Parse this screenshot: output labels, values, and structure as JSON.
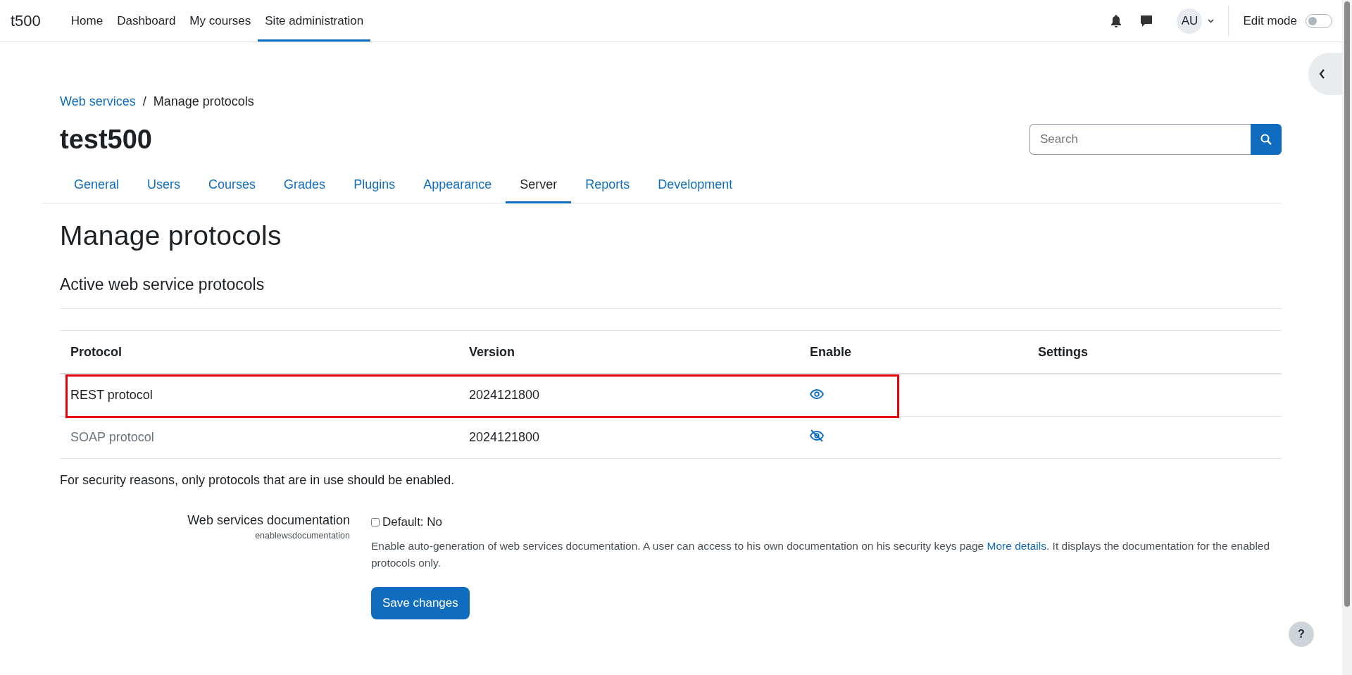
{
  "navbar": {
    "brand": "t500",
    "items": [
      {
        "label": "Home",
        "selected": false
      },
      {
        "label": "Dashboard",
        "selected": false
      },
      {
        "label": "My courses",
        "selected": false
      },
      {
        "label": "Site administration",
        "selected": true
      }
    ],
    "user_initials": "AU",
    "edit_mode": {
      "label": "Edit mode",
      "on": false
    }
  },
  "breadcrumb_separator": "/",
  "breadcrumb": [
    {
      "label": "Web services",
      "kind": "link"
    },
    {
      "label": "Manage protocols",
      "kind": "current"
    }
  ],
  "site_title": "test500",
  "search": {
    "placeholder": "Search"
  },
  "tabs": [
    {
      "label": "General",
      "selected": false
    },
    {
      "label": "Users",
      "selected": false
    },
    {
      "label": "Courses",
      "selected": false
    },
    {
      "label": "Grades",
      "selected": false
    },
    {
      "label": "Plugins",
      "selected": false
    },
    {
      "label": "Appearance",
      "selected": false
    },
    {
      "label": "Server",
      "selected": true
    },
    {
      "label": "Reports",
      "selected": false
    },
    {
      "label": "Development",
      "selected": false
    }
  ],
  "heading": "Manage protocols",
  "subheading": "Active web service protocols",
  "table": {
    "columns": [
      "Protocol",
      "Version",
      "Enable",
      "Settings"
    ],
    "rows": [
      {
        "protocol": "REST protocol",
        "version": "2024121800",
        "enabled": true,
        "highlighted": true
      },
      {
        "protocol": "SOAP protocol",
        "version": "2024121800",
        "enabled": false,
        "highlighted": false
      }
    ]
  },
  "note": "For security reasons, only protocols that are in use should be enabled.",
  "setting": {
    "label": "Web services documentation",
    "name": "enablewsdocumentation",
    "checkbox": {
      "label": "Default: No",
      "checked": false
    },
    "description_before": "Enable auto-generation of web services documentation. A user can access to his own documentation on his security keys page",
    "link": "More details",
    "description_after": ". It displays the documentation for the enabled protocols only."
  },
  "save_button": "Save changes",
  "help_button": "?"
}
